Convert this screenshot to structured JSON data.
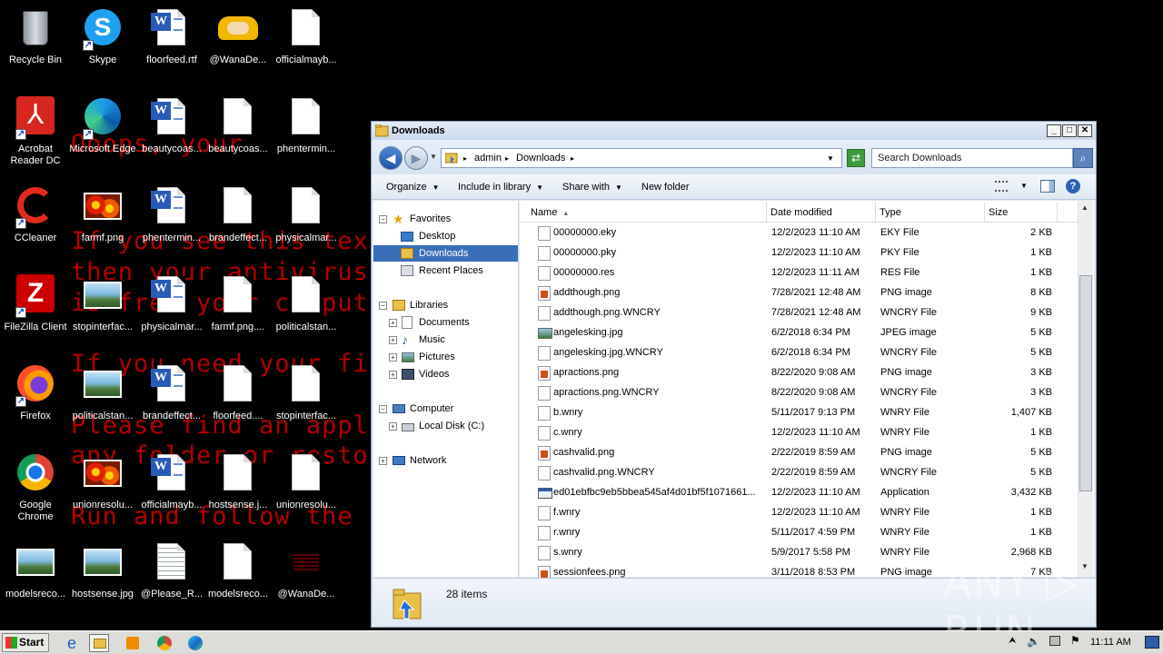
{
  "ransom_text": [
    "Ooops, your",
    "If you see this tex",
    "then your antivirus",
    "is free your comput",
    "If you need your fi",
    "Please find an appl",
    "any folder or resto",
    "Run and follow the"
  ],
  "desktop_icons": [
    {
      "label": "Recycle Bin",
      "kind": "bin"
    },
    {
      "label": "Skype",
      "kind": "skype"
    },
    {
      "label": "floorfeed.rtf",
      "kind": "word"
    },
    {
      "label": "@WanaDe...",
      "kind": "handshake"
    },
    {
      "label": "officialmayb...",
      "kind": "blank"
    },
    {
      "label": "Acrobat Reader DC",
      "kind": "acrobat"
    },
    {
      "label": "Microsoft Edge",
      "kind": "edge"
    },
    {
      "label": "beautycoas...",
      "kind": "word"
    },
    {
      "label": "beautycoas...",
      "kind": "blank"
    },
    {
      "label": "phentermin...",
      "kind": "blank"
    },
    {
      "label": "CCleaner",
      "kind": "ccleaner"
    },
    {
      "label": "farmf.png",
      "kind": "flower"
    },
    {
      "label": "phentermin...",
      "kind": "word"
    },
    {
      "label": "brandeffect...",
      "kind": "blank"
    },
    {
      "label": "physicalmar...",
      "kind": "blank"
    },
    {
      "label": "FileZilla Client",
      "kind": "filezilla"
    },
    {
      "label": "stopinterfac...",
      "kind": "pic"
    },
    {
      "label": "physicalmar...",
      "kind": "word"
    },
    {
      "label": "farmf.png....",
      "kind": "blank"
    },
    {
      "label": "politicalstan...",
      "kind": "blank"
    },
    {
      "label": "Firefox",
      "kind": "firefox"
    },
    {
      "label": "politicalstan...",
      "kind": "pic"
    },
    {
      "label": "brandeffect...",
      "kind": "word"
    },
    {
      "label": "floorfeed....",
      "kind": "blank"
    },
    {
      "label": "stopinterfac...",
      "kind": "blank"
    },
    {
      "label": "Google Chrome",
      "kind": "chrome"
    },
    {
      "label": "unionresolu...",
      "kind": "flower"
    },
    {
      "label": "officialmayb...",
      "kind": "word"
    },
    {
      "label": "hostsense.j...",
      "kind": "blank"
    },
    {
      "label": "unionresolu...",
      "kind": "blank"
    },
    {
      "label": "modelsreco...",
      "kind": "pic"
    },
    {
      "label": "hostsense.jpg",
      "kind": "pic"
    },
    {
      "label": "@Please_R...",
      "kind": "textdoc"
    },
    {
      "label": "modelsreco...",
      "kind": "blank"
    },
    {
      "label": "@WanaDe...",
      "kind": "wana"
    }
  ],
  "window": {
    "title": "Downloads",
    "minimize": "_",
    "maximize": "□",
    "close": "✕",
    "breadcrumb": [
      "admin",
      "Downloads"
    ],
    "search_placeholder": "Search Downloads",
    "toolbar": {
      "organize": "Organize",
      "include": "Include in library",
      "share": "Share with",
      "newfolder": "New folder"
    },
    "nav": {
      "favorites": "Favorites",
      "desktop": "Desktop",
      "downloads": "Downloads",
      "recent": "Recent Places",
      "libraries": "Libraries",
      "documents": "Documents",
      "music": "Music",
      "pictures": "Pictures",
      "videos": "Videos",
      "computer": "Computer",
      "localdisk": "Local Disk (C:)",
      "network": "Network"
    },
    "columns": {
      "name": "Name",
      "date": "Date modified",
      "type": "Type",
      "size": "Size"
    },
    "files": [
      {
        "name": "00000000.eky",
        "date": "12/2/2023 11:10 AM",
        "type": "EKY File",
        "size": "2 KB",
        "icon": "blank"
      },
      {
        "name": "00000000.pky",
        "date": "12/2/2023 11:10 AM",
        "type": "PKY File",
        "size": "1 KB",
        "icon": "blank"
      },
      {
        "name": "00000000.res",
        "date": "12/2/2023 11:11 AM",
        "type": "RES File",
        "size": "1 KB",
        "icon": "blank"
      },
      {
        "name": "addthough.png",
        "date": "7/28/2021 12:48 AM",
        "type": "PNG image",
        "size": "8 KB",
        "icon": "png"
      },
      {
        "name": "addthough.png.WNCRY",
        "date": "7/28/2021 12:48 AM",
        "type": "WNCRY File",
        "size": "9 KB",
        "icon": "blank"
      },
      {
        "name": "angelesking.jpg",
        "date": "6/2/2018 6:34 PM",
        "type": "JPEG image",
        "size": "5 KB",
        "icon": "jpg"
      },
      {
        "name": "angelesking.jpg.WNCRY",
        "date": "6/2/2018 6:34 PM",
        "type": "WNCRY File",
        "size": "5 KB",
        "icon": "blank"
      },
      {
        "name": "apractions.png",
        "date": "8/22/2020 9:08 AM",
        "type": "PNG image",
        "size": "3 KB",
        "icon": "png"
      },
      {
        "name": "apractions.png.WNCRY",
        "date": "8/22/2020 9:08 AM",
        "type": "WNCRY File",
        "size": "3 KB",
        "icon": "blank"
      },
      {
        "name": "b.wnry",
        "date": "5/11/2017 9:13 PM",
        "type": "WNRY File",
        "size": "1,407 KB",
        "icon": "blank"
      },
      {
        "name": "c.wnry",
        "date": "12/2/2023 11:10 AM",
        "type": "WNRY File",
        "size": "1 KB",
        "icon": "blank"
      },
      {
        "name": "cashvalid.png",
        "date": "2/22/2019 8:59 AM",
        "type": "PNG image",
        "size": "5 KB",
        "icon": "png"
      },
      {
        "name": "cashvalid.png.WNCRY",
        "date": "2/22/2019 8:59 AM",
        "type": "WNCRY File",
        "size": "5 KB",
        "icon": "blank"
      },
      {
        "name": "ed01ebfbc9eb5bbea545af4d01bf5f1071661...",
        "date": "12/2/2023 11:10 AM",
        "type": "Application",
        "size": "3,432 KB",
        "icon": "app"
      },
      {
        "name": "f.wnry",
        "date": "12/2/2023 11:10 AM",
        "type": "WNRY File",
        "size": "1 KB",
        "icon": "blank"
      },
      {
        "name": "r.wnry",
        "date": "5/11/2017 4:59 PM",
        "type": "WNRY File",
        "size": "1 KB",
        "icon": "blank"
      },
      {
        "name": "s.wnry",
        "date": "5/9/2017 5:58 PM",
        "type": "WNRY File",
        "size": "2,968 KB",
        "icon": "blank"
      },
      {
        "name": "sessionfees.png",
        "date": "3/11/2018 8:53 PM",
        "type": "PNG image",
        "size": "7 KB",
        "icon": "png"
      }
    ],
    "item_count": "28 items"
  },
  "watermark": "ANY ▷ RUN",
  "taskbar": {
    "start": "Start",
    "clock": "11:11 AM"
  }
}
